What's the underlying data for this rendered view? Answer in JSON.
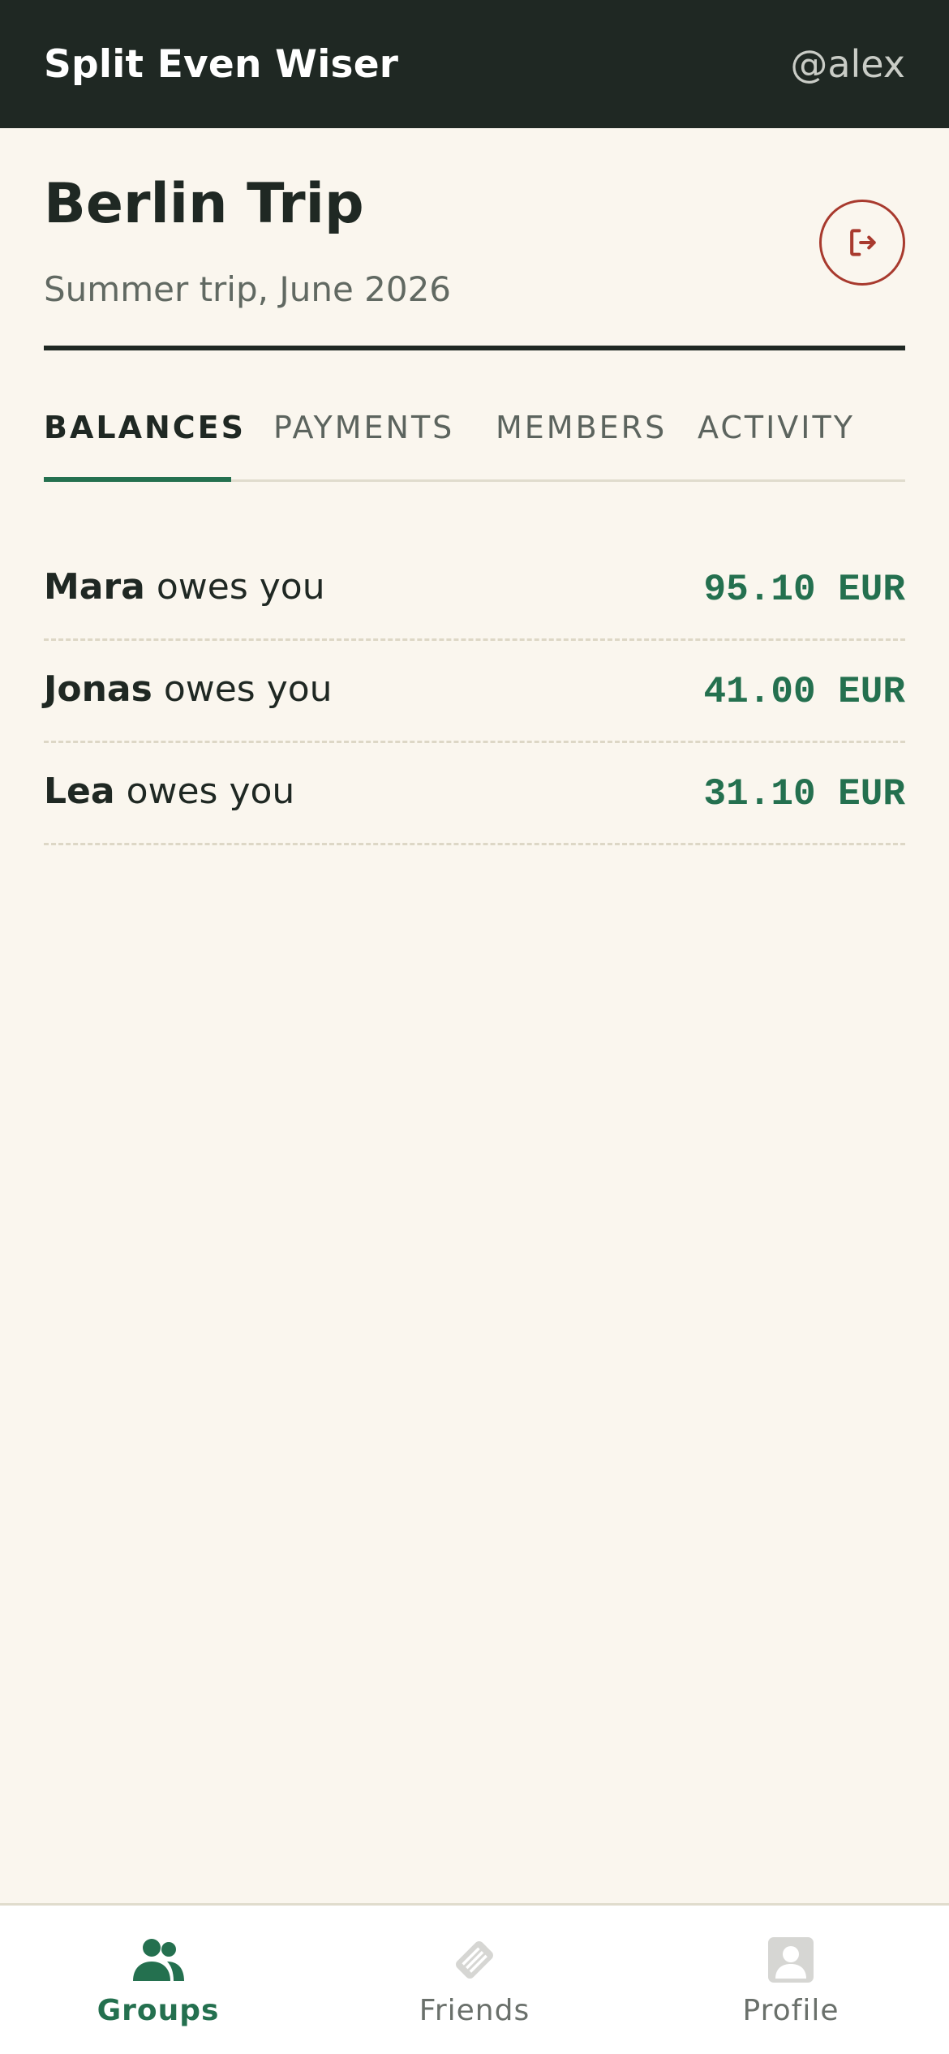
{
  "app": {
    "title": "Split Even Wiser",
    "username": "@alex"
  },
  "group": {
    "title": "Berlin Trip",
    "subtitle": "Summer trip, June 2026",
    "leave_icon": "logout-icon"
  },
  "tabs": [
    {
      "label": "BALANCES",
      "active": true
    },
    {
      "label": "PAYMENTS",
      "active": false
    },
    {
      "label": "MEMBERS",
      "active": false
    },
    {
      "label": "ACTIVITY",
      "active": false
    }
  ],
  "balances": [
    {
      "name": "Mara",
      "text": "owes you",
      "amount": "95.10 EUR"
    },
    {
      "name": "Jonas",
      "text": "owes you",
      "amount": "41.00 EUR"
    },
    {
      "name": "Lea",
      "text": "owes you",
      "amount": "31.10 EUR"
    }
  ],
  "nav": [
    {
      "label": "Groups",
      "icon": "groups-icon",
      "active": true
    },
    {
      "label": "Friends",
      "icon": "handshake-icon",
      "active": false
    },
    {
      "label": "Profile",
      "icon": "profile-icon",
      "active": false
    }
  ],
  "colors": {
    "topbar": "#1f2823",
    "background": "#faf6ee",
    "accent": "#24704f",
    "danger": "#a83a2e"
  }
}
